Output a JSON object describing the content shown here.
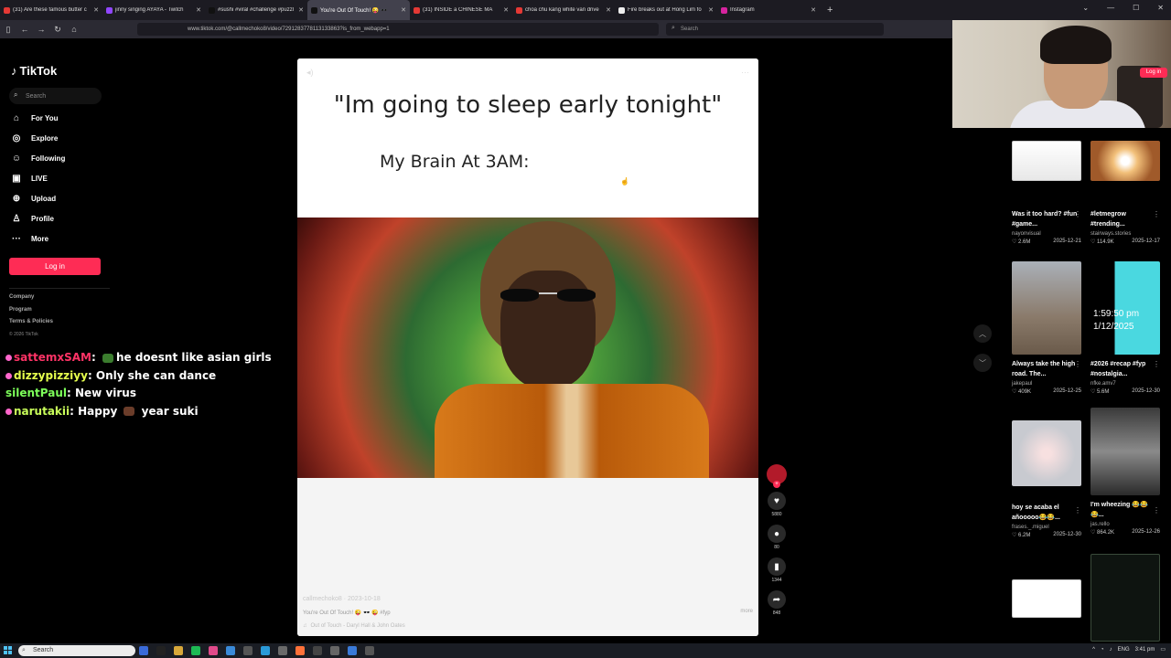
{
  "browser": {
    "tabs": [
      {
        "label": "(31) Are these famous butter c",
        "color": "#e53935",
        "active": false
      },
      {
        "label": "jinny singing AYAYA - Twitch",
        "color": "#9146ff",
        "active": false
      },
      {
        "label": "#sushi #viral #challenge #puzzl",
        "color": "#111111",
        "active": false
      },
      {
        "label": "You're Out Of Touch! 😜 🕶️",
        "color": "#111111",
        "active": true
      },
      {
        "label": "(31) INSIDE a CHINESE MA",
        "color": "#e53935",
        "active": false
      },
      {
        "label": "choa chu kang white van drive",
        "color": "#e53935",
        "active": false
      },
      {
        "label": "Fire breaks out at Hong Lim fo",
        "color": "#eeeeee",
        "active": false
      },
      {
        "label": "Instagram",
        "color": "#d6249f",
        "active": false
      }
    ],
    "url": "www.tiktok.com/@callmechoko8/video/7291283778113133863?is_from_webapp=1",
    "search_placeholder": "Search"
  },
  "sidebar": {
    "logo": "TikTok",
    "search_placeholder": "Search",
    "items": [
      {
        "label": "For You",
        "icon": "home-icon"
      },
      {
        "label": "Explore",
        "icon": "compass-icon"
      },
      {
        "label": "Following",
        "icon": "following-icon"
      },
      {
        "label": "LIVE",
        "icon": "live-icon"
      },
      {
        "label": "Upload",
        "icon": "upload-icon"
      },
      {
        "label": "Profile",
        "icon": "profile-icon"
      },
      {
        "label": "More",
        "icon": "more-icon"
      }
    ],
    "login": "Log in",
    "footer": [
      "Company",
      "Program",
      "Terms & Policies"
    ],
    "copyright": "© 2026 TikTok"
  },
  "chat": [
    {
      "user": "sattemxSAM",
      "text": "he doesnt like asian girls"
    },
    {
      "user": "dizzypizziyy",
      "text": "Only she can dance"
    },
    {
      "user": "silentPaul",
      "text": "New virus"
    },
    {
      "user": "narutakii",
      "text": "Happy",
      "text2": "year suki"
    }
  ],
  "video": {
    "quote": "\"Im going to sleep early tonight\"",
    "subtitle": "My Brain At 3AM:",
    "author": "callmechoko8 · 2023-10-18",
    "caption": "You're Out Of Touch! 😜 🕶️ 😜 #fyp",
    "music": "Out of Touch - Daryl Hall & John Oates",
    "more": "more"
  },
  "actions": {
    "likes": "5880",
    "comments": "80",
    "saves": "1344",
    "shares": "848"
  },
  "webcam": {
    "login_label": "Log in"
  },
  "recommendations": [
    {
      "title": "Was it too hard? #fun #game...",
      "author": "nayonvisual",
      "views": "2.6M",
      "date": "2025-12-21"
    },
    {
      "title": "#letmegrow #trending...",
      "author": "stairways.stories",
      "views": "114.9K",
      "date": "2025-12-17"
    },
    {
      "title": "Always take the high road. The...",
      "author": "jakepaul",
      "views": "409K",
      "date": "2025-12-25"
    },
    {
      "title": "#2026 #recap #fyp #nostalgia...",
      "author": "nfke.amv7",
      "views": "5.6M",
      "date": "2025-12-30",
      "overlay": "1:59:50 pm",
      "overlay2": "1/12/2025"
    },
    {
      "title": "hoy se acaba el añooooo😂😂...",
      "author": "frases._.miguel",
      "views": "6.2M",
      "date": "2025-12-30"
    },
    {
      "title": "I'm wheezing 😂😂😂...",
      "author": "jas.rello",
      "views": "864.2K",
      "date": "2025-12-26"
    }
  ],
  "taskbar": {
    "search": "Search",
    "lang": "ENG",
    "time": "3:41 pm"
  }
}
